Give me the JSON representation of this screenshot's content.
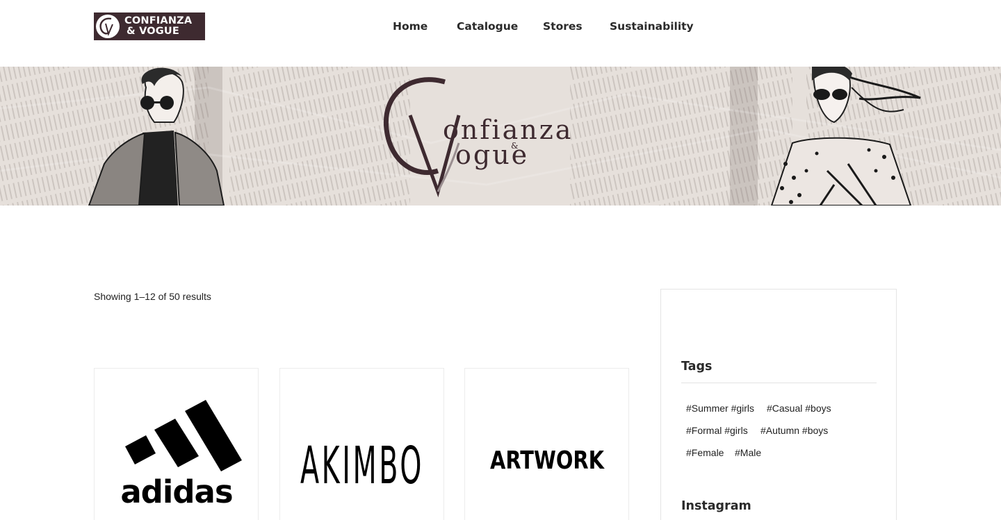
{
  "brand": {
    "logo_line1": "CONFIANZA",
    "logo_line2": "& VOGUE",
    "banner_title": "Confianza & Vogue",
    "colors": {
      "brand": "#3e2a30",
      "text": "#1e1e1e"
    }
  },
  "nav": {
    "items": [
      {
        "label": "Home"
      },
      {
        "label": "Catalogue"
      },
      {
        "label": "Stores"
      },
      {
        "label": "Sustainability"
      }
    ]
  },
  "shop": {
    "result_count": "Showing 1–12 of 50 results",
    "products": [
      {
        "brand_logo": "adidas"
      },
      {
        "brand_logo": "AKIMBO"
      },
      {
        "brand_logo": "ARTWORK"
      }
    ]
  },
  "sidebar": {
    "tags_title": "Tags",
    "tags": [
      "#Summer #girls",
      "#Casual #boys",
      "#Formal #girls",
      "#Autumn #boys",
      "#Female",
      "#Male"
    ],
    "instagram_title": "Instagram"
  }
}
